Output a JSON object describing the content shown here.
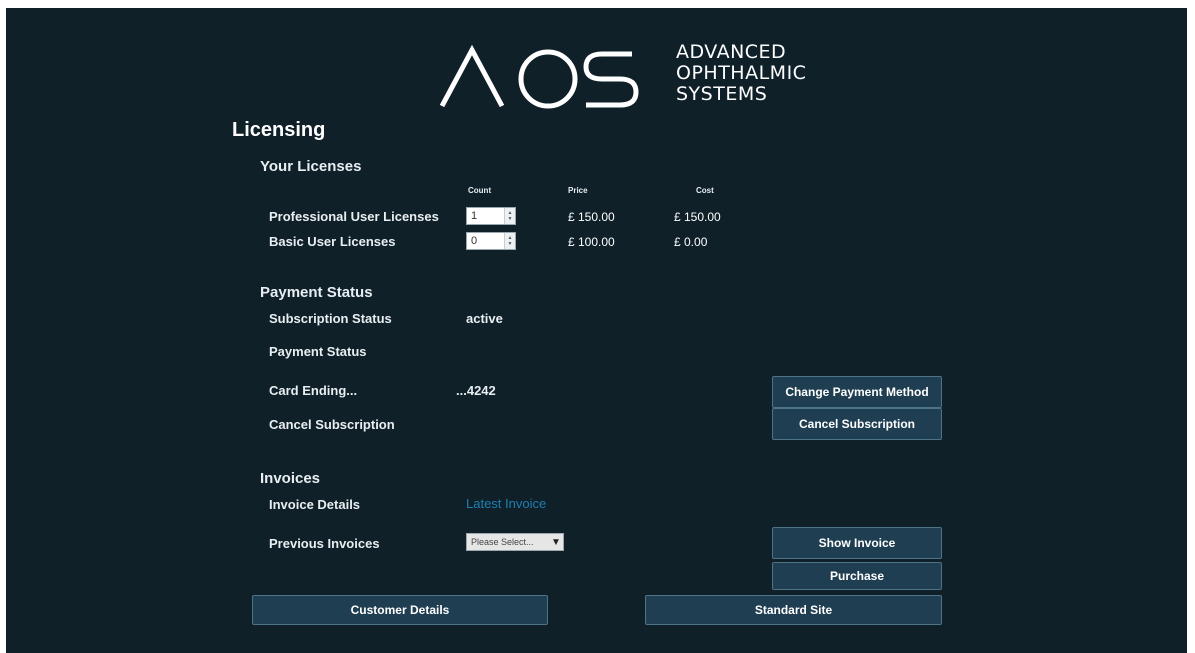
{
  "brand": {
    "logo_letters": "AOS",
    "name_line1": "ADVANCED",
    "name_line2": "OPHTHALMIC",
    "name_line3": "SYSTEMS"
  },
  "page": {
    "title": "Licensing"
  },
  "licenses": {
    "heading": "Your Licenses",
    "columns": {
      "count": "Count",
      "price": "Price",
      "cost": "Cost"
    },
    "rows": [
      {
        "label": "Professional User Licenses",
        "count": "1",
        "price": "£ 150.00",
        "cost": "£ 150.00"
      },
      {
        "label": "Basic User Licenses",
        "count": "0",
        "price": "£ 100.00",
        "cost": "£ 0.00"
      }
    ]
  },
  "payment": {
    "heading": "Payment Status",
    "subscription_status_label": "Subscription Status",
    "subscription_status_value": "active",
    "payment_status_label": "Payment Status",
    "card_ending_label": "Card Ending...",
    "card_ending_value": "...4242",
    "change_method_button": "Change Payment Method",
    "cancel_label": "Cancel Subscription",
    "cancel_button": "Cancel Subscription"
  },
  "invoices": {
    "heading": "Invoices",
    "details_label": "Invoice Details",
    "latest_link": "Latest Invoice",
    "previous_label": "Previous Invoices",
    "select_value": "Please Select...",
    "show_button": "Show Invoice",
    "purchase_button": "Purchase"
  },
  "footer": {
    "customer_details_button": "Customer Details",
    "standard_site_button": "Standard Site"
  },
  "colors": {
    "background": "#0f2029",
    "button": "#1f3e52",
    "link": "#1f7fb0"
  }
}
